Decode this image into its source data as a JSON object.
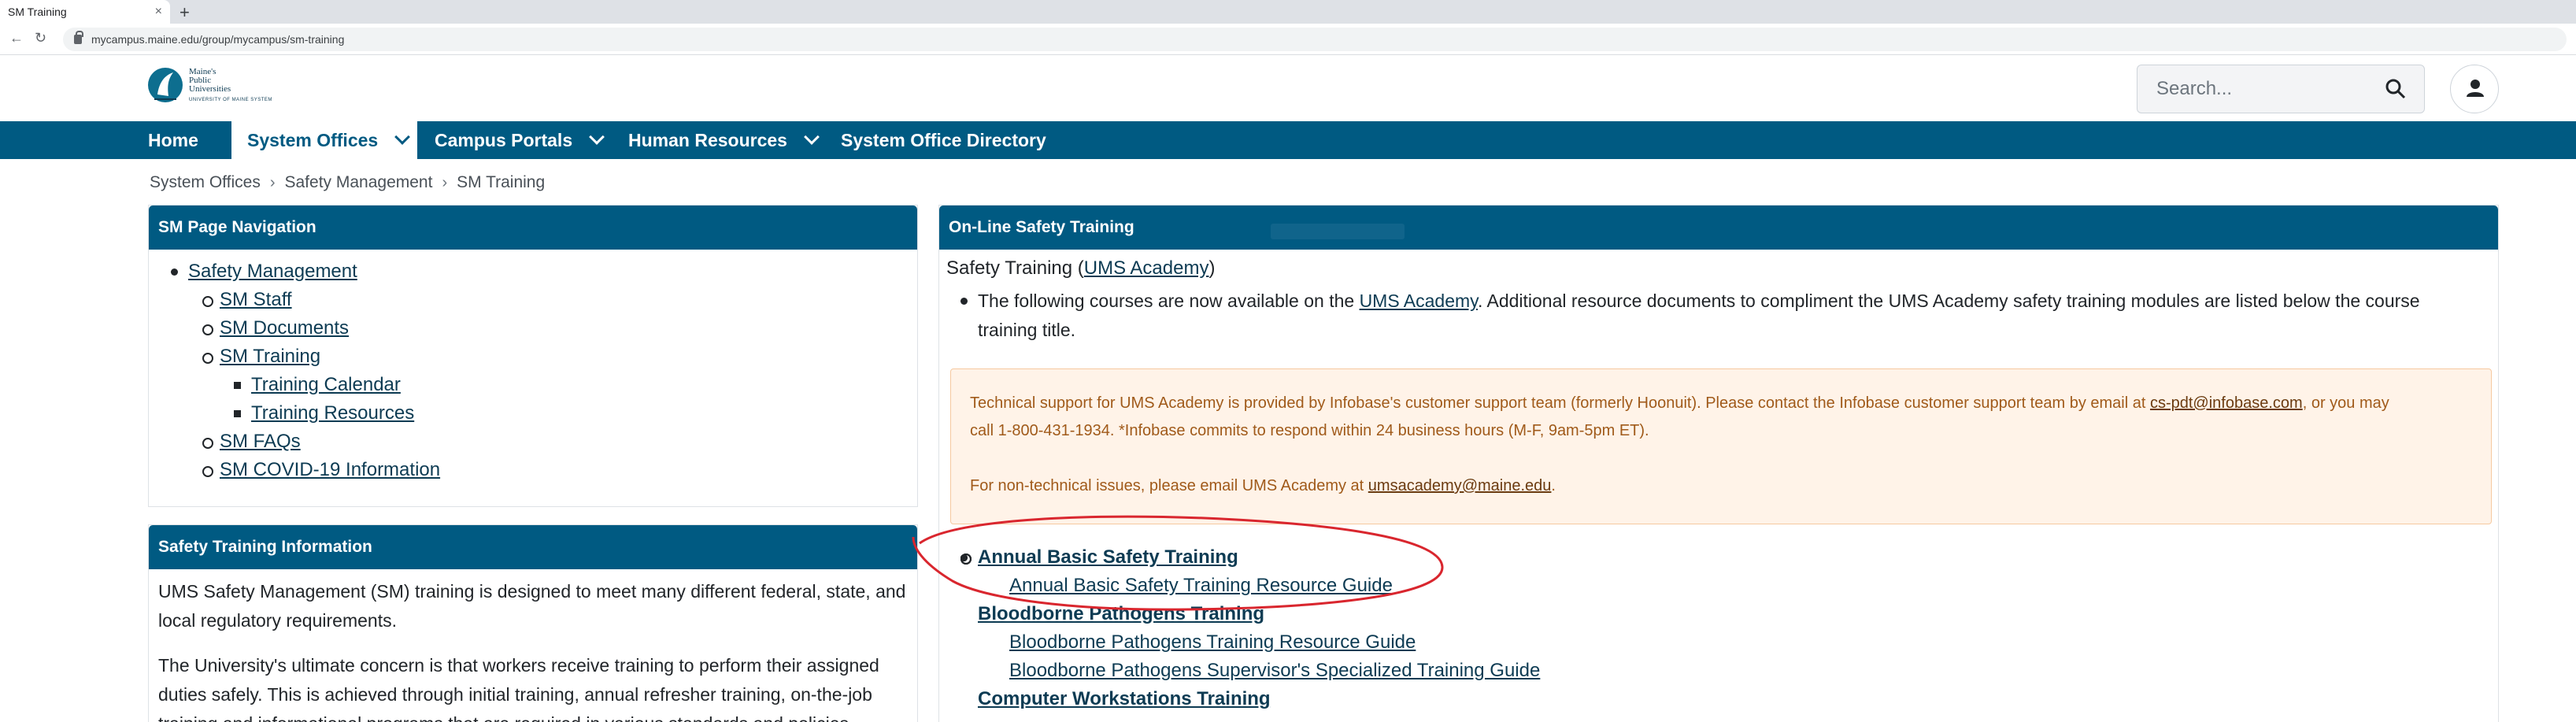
{
  "browser": {
    "tab_title": "SM Training",
    "tab_close": "×",
    "new_tab": "+",
    "url": "mycampus.maine.edu/group/mycampus/sm-training",
    "back": "←",
    "reload": "↻"
  },
  "header": {
    "logo_lines": [
      "Maine's",
      "Public",
      "Universities"
    ],
    "logo_small": "UNIVERSITY OF MAINE SYSTEM",
    "search_placeholder": "Search..."
  },
  "mainnav": {
    "items": [
      "Home",
      "System Offices",
      "Campus Portals",
      "Human Resources",
      "System Office Directory"
    ]
  },
  "breadcrumb": {
    "items": [
      "System Offices",
      "Safety Management",
      "SM Training"
    ],
    "separator": "›"
  },
  "left_nav_panel": {
    "title": "SM Page Navigation",
    "items": {
      "top": "Safety Management",
      "staff": "SM Staff",
      "documents": "SM Documents",
      "training": "SM Training",
      "calendar": "Training Calendar",
      "resources": "Training Resources",
      "faqs": "SM FAQs",
      "covid": "SM COVID-19 Information"
    }
  },
  "info_panel": {
    "title": "Safety Training Information",
    "p1": "UMS Safety Management (SM) training is designed to meet many different federal, state, and local regulatory requirements.",
    "p2_line1": "The University's ultimate concern is that workers receive training to perform their assigned",
    "p2_line2": "duties safely.  This is achieved through initial training, annual refresher training, on-the-job",
    "p2_line3": "training and informational programs that are required in various standards and policies."
  },
  "online_panel": {
    "title": "On-Line Safety Training",
    "heading_prefix": "Safety Training (",
    "heading_link": "UMS Academy",
    "heading_suffix": ")",
    "bullet_prefix": "The following courses are now available on the ",
    "bullet_link": "UMS Academy",
    "bullet_suffix": ".  Additional resource documents to compliment the UMS Academy safety training modules are listed below the course",
    "bullet_line2": "training title.",
    "alert_line1_prefix": "Technical support for UMS Academy is provided by Infobase's customer support team (formerly Hoonuit). Please contact the Infobase customer support team by email at ",
    "alert_email1": "cs-pdt@infobase.com",
    "alert_line1_suffix": ", or you may",
    "alert_line2": "call 1-800-431-1934. *Infobase commits to respond within 24 business hours (M-F, 9am-5pm ET).",
    "alert_line3_prefix": "For non-technical issues, please email UMS Academy at ",
    "alert_email2": "umsacademy@maine.edu",
    "alert_line3_suffix": ".",
    "courses": {
      "c1": "Annual Basic Safety Training",
      "c1_sub1": "Annual Basic Safety Training Resource Guide",
      "c2": "Bloodborne Pathogens Training",
      "c2_sub1": "Bloodborne Pathogens Training Resource Guide",
      "c2_sub2": "Bloodborne Pathogens Supervisor's Specialized Training Guide",
      "c3": "Computer Workstations Training "
    }
  },
  "colors": {
    "brand": "#005a82",
    "annotation": "#d9262e"
  }
}
